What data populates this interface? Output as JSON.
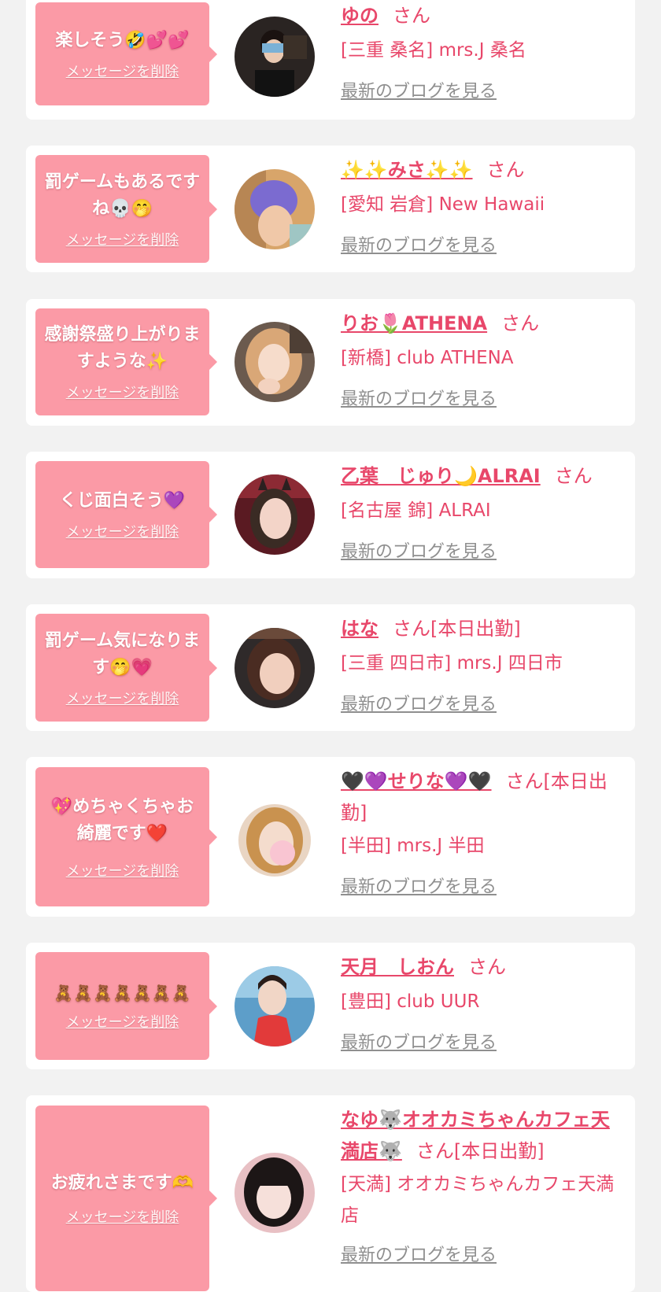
{
  "delete_label": "メッセージを削除",
  "blog_label": "最新のブログを見る",
  "san_label": "さん",
  "colors": {
    "page_bg": "#f2f2f2",
    "card_bg": "#ffffff",
    "bubble": "#fb9aa6",
    "name": "#e8476a",
    "link_gray": "#8f8f8f"
  },
  "items": [
    {
      "message": "楽しそう🤣💕💕",
      "name": "ゆの",
      "suffix": "",
      "shop": "[三重 桑名] mrs.J 桑名"
    },
    {
      "message": "罰ゲームもあるですね💀🤭",
      "name": "✨✨みさ✨✨",
      "suffix": "",
      "shop": "[愛知 岩倉] New Hawaii"
    },
    {
      "message": "感謝祭盛り上がりますような✨",
      "name": "りお🌷ATHENA",
      "suffix": "",
      "shop": "[新橋] club ATHENA"
    },
    {
      "message": "くじ面白そう💜",
      "name": "乙葉　じゅり🌙ALRAI",
      "suffix": "",
      "shop": "[名古屋 錦] ALRAI"
    },
    {
      "message": "罰ゲーム気になります🤭💗",
      "name": "はな",
      "suffix": "[本日出勤]",
      "shop": "[三重 四日市] mrs.J 四日市"
    },
    {
      "message": "💖めちゃくちゃお綺麗です❤️",
      "name": "🖤💜せりな💜🖤",
      "suffix": "[本日出勤]",
      "shop": "[半田] mrs.J 半田"
    },
    {
      "message": "🧸🧸🧸🧸🧸🧸🧸",
      "name": "天月　しおん",
      "suffix": "",
      "shop": "[豊田] club UUR"
    },
    {
      "message": "お疲れさまです🫶",
      "name": "なゆ🐺オオカミちゃんカフェ天満店🐺",
      "suffix": "[本日出勤]",
      "shop": "[天満] オオカミちゃんカフェ天満店"
    }
  ]
}
